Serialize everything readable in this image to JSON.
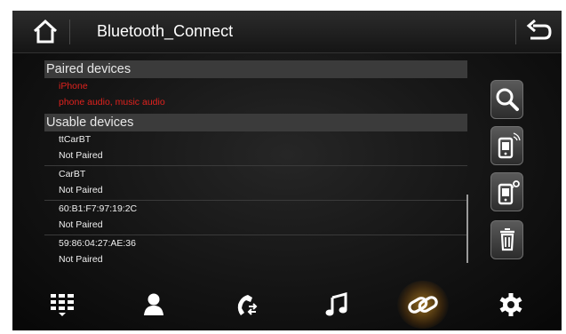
{
  "header": {
    "title": "Bluetooth_Connect",
    "home_icon": "home-icon",
    "back_icon": "back-arrow-icon"
  },
  "paired_section": {
    "header": "Paired devices",
    "devices": [
      {
        "name": "iPhone",
        "status": "phone audio, music audio"
      }
    ]
  },
  "usable_section": {
    "header": "Usable devices",
    "devices": [
      {
        "name": "ttCarBT",
        "status": "Not Paired"
      },
      {
        "name": "CarBT",
        "status": "Not Paired"
      },
      {
        "name": "60:B1:F7:97:19:2C",
        "status": "Not Paired"
      },
      {
        "name": "59:86:04:27:AE:36",
        "status": "Not Paired"
      }
    ]
  },
  "side_buttons": [
    "search-icon",
    "phone-connect-icon",
    "phone-settings-icon",
    "trash-icon"
  ],
  "bottom_nav": {
    "items": [
      "keypad-icon",
      "contacts-icon",
      "call-log-icon",
      "music-icon",
      "link-icon",
      "settings-icon"
    ],
    "active": "link-icon"
  },
  "colors": {
    "paired_text": "#e0221e",
    "accent_glow": "#ffb428",
    "text": "#f0f0f0",
    "section_bg": "#3b3b3b"
  }
}
